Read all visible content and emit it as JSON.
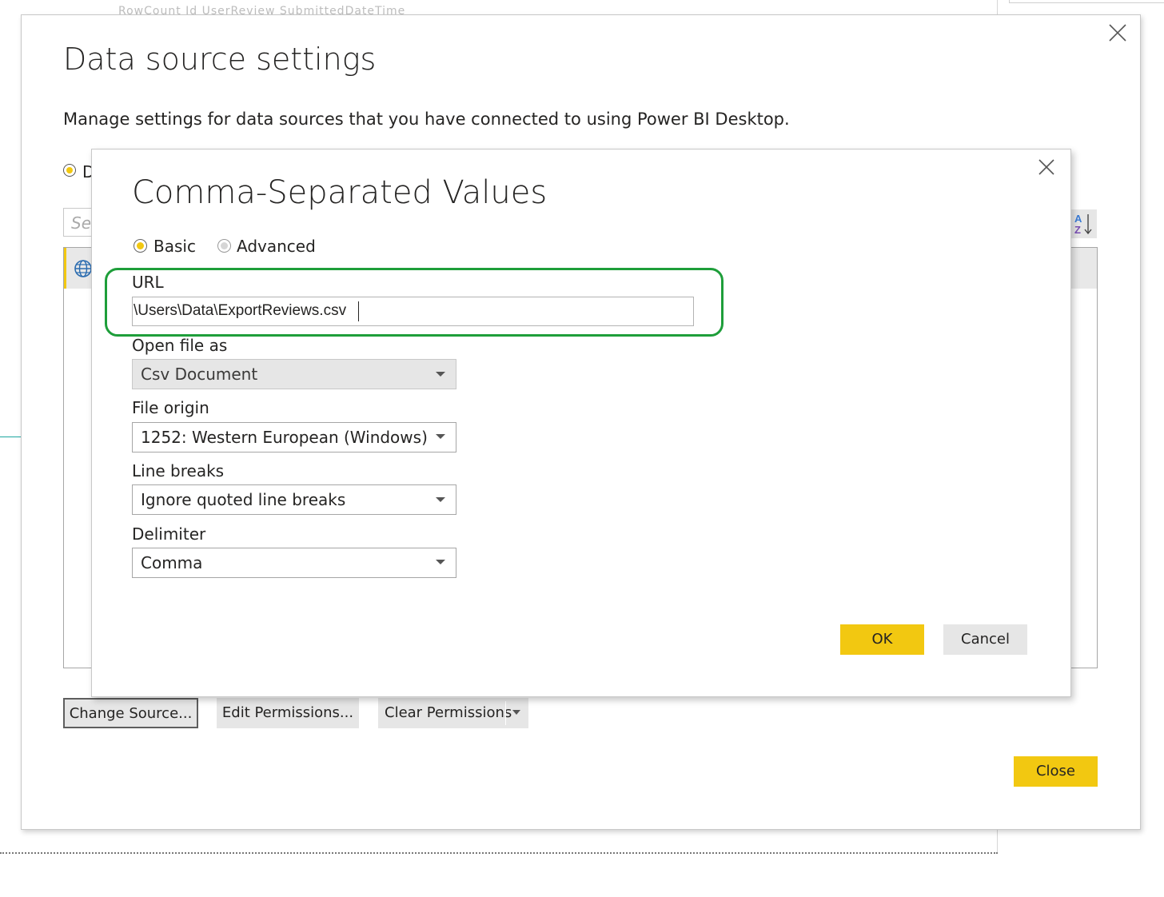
{
  "outer_dialog": {
    "title": "Data source settings",
    "description": "Manage settings for data sources that you have connected to using Power BI Desktop.",
    "radio_partial_label": "D",
    "search_placeholder_partial": "Sea",
    "buttons": {
      "change_source": "Change Source...",
      "edit_permissions": "Edit Permissions...",
      "clear_permissions": "Clear Permissions",
      "close": "Close"
    }
  },
  "csv_dialog": {
    "title": "Comma-Separated Values",
    "mode": {
      "basic_label": "Basic",
      "advanced_label": "Advanced",
      "selected": "Basic"
    },
    "url": {
      "label": "URL",
      "value": "\\Users\\Data\\ExportReviews.csv"
    },
    "open_file_as": {
      "label": "Open file as",
      "value": "Csv Document"
    },
    "file_origin": {
      "label": "File origin",
      "value": "1252: Western European (Windows)"
    },
    "line_breaks": {
      "label": "Line breaks",
      "value": "Ignore quoted line breaks"
    },
    "delimiter": {
      "label": "Delimiter",
      "value": "Comma"
    },
    "buttons": {
      "ok": "OK",
      "cancel": "Cancel"
    }
  },
  "colors": {
    "accent_yellow": "#f2c811",
    "highlight_green": "#1e9e3a",
    "button_gray": "#e6e6e6"
  },
  "icons": [
    "close-icon",
    "globe-icon",
    "sort-az-icon",
    "chevron-down-icon"
  ]
}
